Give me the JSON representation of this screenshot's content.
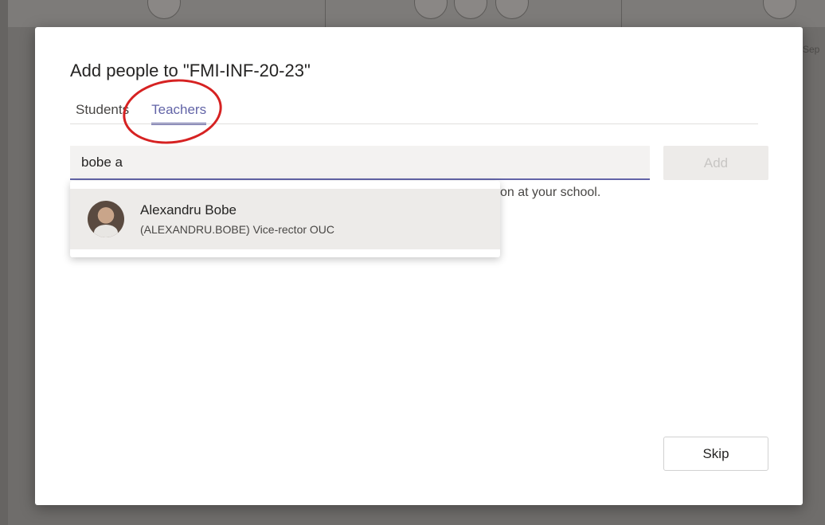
{
  "background": {
    "side_text": "Sep"
  },
  "dialog": {
    "title": "Add people to \"FMI-INF-20-23\"",
    "tabs": [
      {
        "label": "Students",
        "active": false
      },
      {
        "label": "Teachers",
        "active": true
      }
    ],
    "search": {
      "value": "bobe a",
      "placeholder": ""
    },
    "add_label": "Add",
    "helper_text": "on at your school.",
    "suggestions": [
      {
        "name": "Alexandru Bobe",
        "detail": "(ALEXANDRU.BOBE) Vice-rector OUC"
      }
    ],
    "skip_label": "Skip"
  },
  "colors": {
    "accent": "#6264a7",
    "annotation": "#d62222"
  }
}
